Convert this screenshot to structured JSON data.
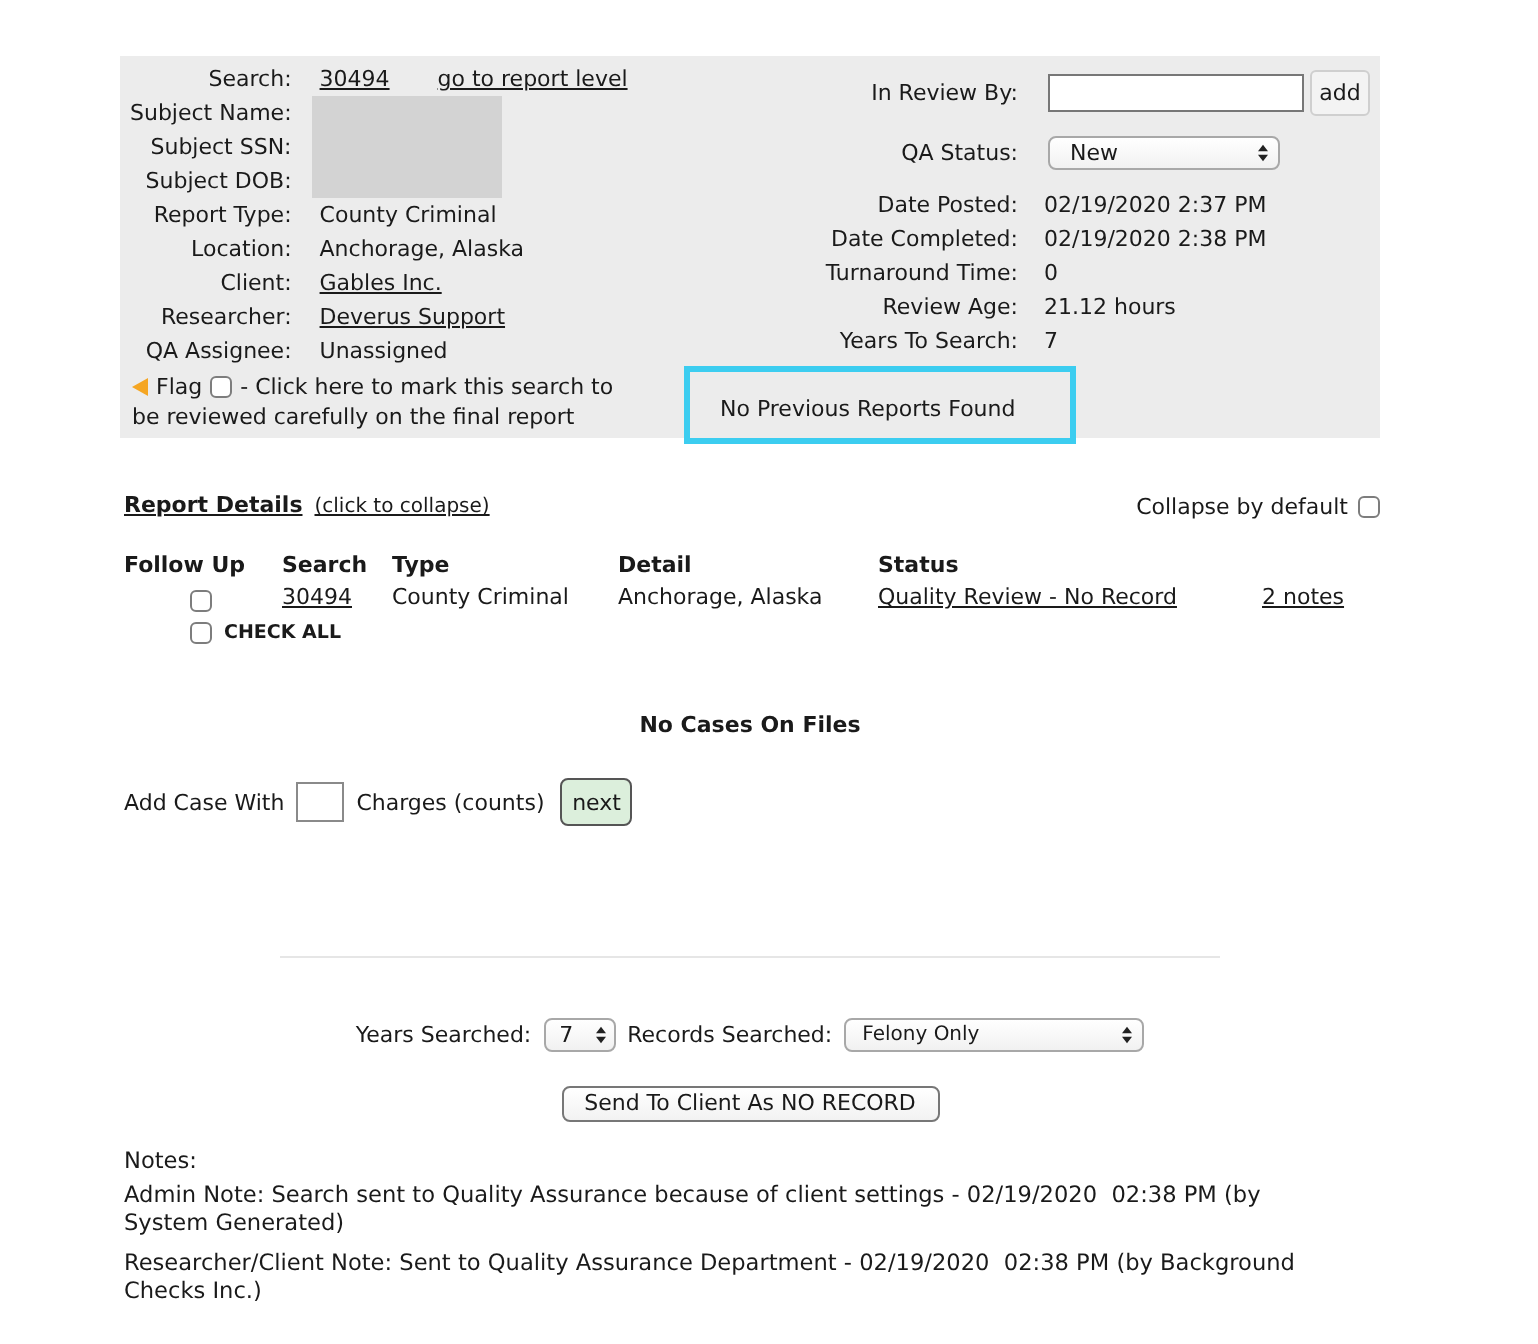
{
  "search_panel": {
    "fields": [
      {
        "label": "Search:",
        "values": [
          {
            "text": "30494",
            "link": true
          },
          {
            "text": "go to report level",
            "link": true
          }
        ]
      },
      {
        "label": "Subject Name:",
        "redacted": true
      },
      {
        "label": "Subject SSN:",
        "redacted": true
      },
      {
        "label": "Subject DOB:",
        "redacted": true
      },
      {
        "label": "Report Type:",
        "values": [
          {
            "text": "County Criminal",
            "link": false
          }
        ]
      },
      {
        "label": "Location:",
        "values": [
          {
            "text": "Anchorage, Alaska",
            "link": false
          }
        ]
      },
      {
        "label": "Client:",
        "values": [
          {
            "text": "Gables Inc.",
            "link": true
          }
        ]
      },
      {
        "label": "Researcher:",
        "values": [
          {
            "text": "Deverus Support",
            "link": true
          }
        ]
      },
      {
        "label": "QA Assignee:",
        "values": [
          {
            "text": "Unassigned",
            "link": false
          }
        ]
      }
    ],
    "flag": {
      "label": "Flag",
      "checked": false,
      "description_lines": [
        "- Click here to mark this search to",
        "be reviewed carefully on the final report"
      ]
    },
    "in_review_by": {
      "label": "In Review By:",
      "button": "add"
    },
    "qa_status": {
      "label": "QA Status:",
      "value": "New"
    },
    "details": [
      {
        "label": "Date Posted:",
        "value": "02/19/2020 2:37 PM"
      },
      {
        "label": "Date Completed:",
        "value": "02/19/2020 2:38 PM"
      },
      {
        "label": "Turnaround Time:",
        "value": "0"
      },
      {
        "label": "Review Age:",
        "value": "21.12 hours"
      },
      {
        "label": "Years To Search:",
        "value": "7"
      }
    ],
    "notice": "No Previous Reports Found"
  },
  "report_details": {
    "title": "Report Details",
    "collapse_link": "(click to collapse)",
    "collapse_default": {
      "label": "Collapse by default",
      "checked": false
    },
    "columns": [
      "Follow Up",
      "Search",
      "Type",
      "Detail",
      "Status"
    ],
    "rows": [
      {
        "follow_up": false,
        "search": "30494",
        "type": "County Criminal",
        "detail": "Anchorage, Alaska",
        "status": "Quality Review - No Record",
        "notes": "2 notes"
      }
    ],
    "check_all": {
      "label": "CHECK ALL",
      "checked": false
    }
  },
  "cases": {
    "message": "No Cases On Files",
    "prefix": "Add Case With",
    "suffix": "Charges (counts)",
    "button": "next"
  },
  "search_scope": {
    "years": {
      "label": "Years Searched:",
      "value": "7"
    },
    "records": {
      "label": "Records Searched:",
      "value": "Felony Only"
    }
  },
  "send_button": "Send To Client As NO RECORD",
  "notes": {
    "title": "Notes:",
    "items": [
      "Admin Note: Search sent to Quality Assurance because of client settings - 02/19/2020  02:38 PM (by System Generated)",
      "Researcher/Client Note: Sent to Quality Assurance Department - 02/19/2020  02:38 PM (by Background Checks Inc.)"
    ]
  }
}
